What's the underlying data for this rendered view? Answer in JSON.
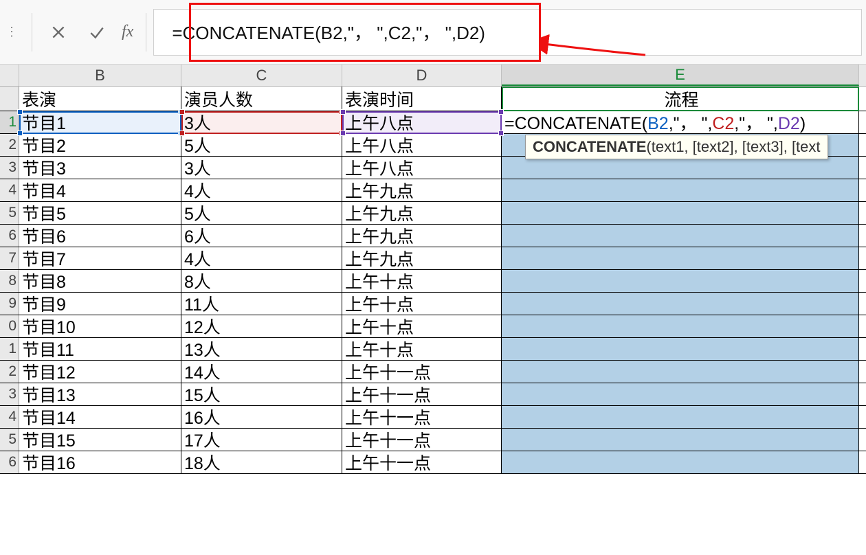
{
  "formula_bar": {
    "fx_label": "fx",
    "formula_text": "=CONCATENATE(B2,\"，  \",C2,\"，  \",D2)"
  },
  "columns": [
    "B",
    "C",
    "D",
    "E"
  ],
  "headers": {
    "B": "表演",
    "C": "演员人数",
    "D": "表演时间",
    "E": "流程"
  },
  "active_cell": {
    "formula_prefix": "=CONCATENATE(",
    "ref_b2": "B2",
    "sep1": ",\"，  \",",
    "ref_c2": "C2",
    "sep2": ",\"，  \",",
    "ref_d2": "D2",
    "suffix": ")"
  },
  "tooltip": {
    "func": "CONCATENATE",
    "args": "(text1, [text2], [text3], [text"
  },
  "rows": [
    {
      "n": "1",
      "B": "节目1",
      "C": "3人",
      "D": "上午八点"
    },
    {
      "n": "2",
      "B": "节目2",
      "C": "5人",
      "D": "上午八点"
    },
    {
      "n": "3",
      "B": "节目3",
      "C": "3人",
      "D": "上午八点"
    },
    {
      "n": "4",
      "B": "节目4",
      "C": "4人",
      "D": "上午九点"
    },
    {
      "n": "5",
      "B": "节目5",
      "C": "5人",
      "D": "上午九点"
    },
    {
      "n": "6",
      "B": "节目6",
      "C": "6人",
      "D": "上午九点"
    },
    {
      "n": "7",
      "B": "节目7",
      "C": "4人",
      "D": "上午九点"
    },
    {
      "n": "8",
      "B": "节目8",
      "C": "8人",
      "D": "上午十点"
    },
    {
      "n": "9",
      "B": "节目9",
      "C": "11人",
      "D": "上午十点"
    },
    {
      "n": "0",
      "B": "节目10",
      "C": "12人",
      "D": "上午十点"
    },
    {
      "n": "1",
      "B": "节目11",
      "C": "13人",
      "D": "上午十点"
    },
    {
      "n": "2",
      "B": "节目12",
      "C": "14人",
      "D": "上午十一点"
    },
    {
      "n": "3",
      "B": "节目13",
      "C": "15人",
      "D": "上午十一点"
    },
    {
      "n": "4",
      "B": "节目14",
      "C": "16人",
      "D": "上午十一点"
    },
    {
      "n": "5",
      "B": "节目15",
      "C": "17人",
      "D": "上午十一点"
    },
    {
      "n": "6",
      "B": "节目16",
      "C": "18人",
      "D": "上午十一点"
    }
  ]
}
